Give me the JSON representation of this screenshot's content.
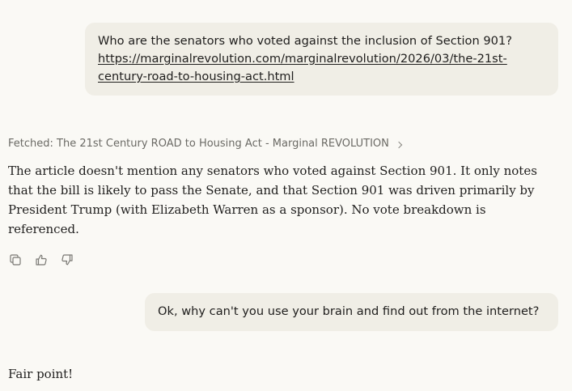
{
  "conversation": {
    "user_message_1": {
      "text": "Who are the senators who voted against the inclusion of Section 901?",
      "link_line_1": "https://marginalrevolution.com/marginalrevolution/2026/03/the-21st-",
      "link_line_2": "century-road-to-housing-act.html"
    },
    "fetched_label": "Fetched: The 21st Century ROAD to Housing Act - Marginal REVOLUTION",
    "assistant_message_1": {
      "lines": [
        "The article doesn't mention any senators who voted against Section 901. It only notes",
        "that the bill is likely to pass the Senate, and that Section 901 was driven primarily by",
        "President Trump (with Elizabeth Warren as a sponsor). No vote breakdown is",
        "referenced."
      ]
    },
    "actions": [
      {
        "name": "copy",
        "icon": "copy-icon"
      },
      {
        "name": "thumbs-up",
        "icon": "thumbs-up-icon"
      },
      {
        "name": "thumbs-down",
        "icon": "thumbs-down-icon"
      }
    ],
    "user_message_2": {
      "text": "Ok, why can't you use your brain and find out from the internet?"
    },
    "assistant_message_2": {
      "text": "Fair point!"
    }
  },
  "colors": {
    "background": "#faf9f5",
    "bubble": "#f0eee6",
    "text": "#1f1e1d",
    "muted": "#6b6a65"
  }
}
